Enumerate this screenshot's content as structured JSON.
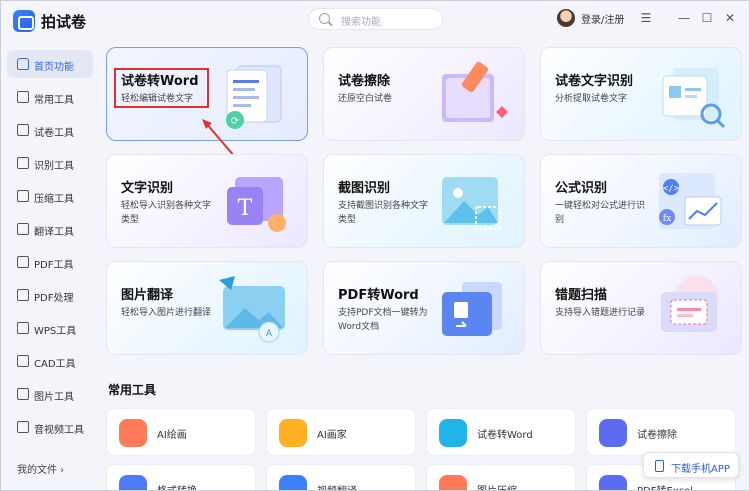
{
  "app": {
    "title": "拍试卷"
  },
  "search": {
    "placeholder": "搜索功能"
  },
  "user": {
    "login_label": "登录/注册"
  },
  "window_controls": {
    "menu": "☰",
    "minimize": "—",
    "maximize": "☐",
    "close": "✕"
  },
  "sidebar": {
    "items": [
      {
        "label": "首页功能",
        "icon": "home-icon",
        "active": true
      },
      {
        "label": "常用工具",
        "icon": "layers-icon"
      },
      {
        "label": "试卷工具",
        "icon": "document-icon"
      },
      {
        "label": "识别工具",
        "icon": "scan-icon"
      },
      {
        "label": "压缩工具",
        "icon": "compress-icon"
      },
      {
        "label": "翻译工具",
        "icon": "translate-icon"
      },
      {
        "label": "PDF工具",
        "icon": "pdf-icon"
      },
      {
        "label": "PDF处理",
        "icon": "pdf-process-icon"
      },
      {
        "label": "WPS工具",
        "icon": "wps-icon"
      },
      {
        "label": "CAD工具",
        "icon": "cad-icon"
      },
      {
        "label": "图片工具",
        "icon": "image-icon"
      },
      {
        "label": "音视频工具",
        "icon": "video-icon"
      }
    ],
    "my_files": "我的文件 ›"
  },
  "cards": [
    {
      "title": "试卷转Word",
      "desc": "轻松编辑试卷文字",
      "icon": "word-document-icon"
    },
    {
      "title": "试卷擦除",
      "desc": "还原空白试卷",
      "icon": "eraser-scroll-icon"
    },
    {
      "title": "试卷文字识别",
      "desc": "分析提取试卷文字",
      "icon": "text-scan-icon"
    },
    {
      "title": "文字识别",
      "desc": "轻松导入识别各种文字类型",
      "icon": "text-recognition-icon"
    },
    {
      "title": "截图识别",
      "desc": "支持截图识别各种文字类型",
      "icon": "screenshot-icon"
    },
    {
      "title": "公式识别",
      "desc": "一键轻松对公式进行识别",
      "icon": "formula-icon"
    },
    {
      "title": "图片翻译",
      "desc": "轻松导入图片进行翻译",
      "icon": "image-translate-icon"
    },
    {
      "title": "PDF转Word",
      "desc": "支持PDF文档一键转为Word文档",
      "icon": "pdf-to-word-icon"
    },
    {
      "title": "错题扫描",
      "desc": "支持导入错题进行记录",
      "icon": "mistake-scan-icon"
    }
  ],
  "common_tools": {
    "title": "常用工具",
    "items": [
      {
        "label": "AI绘画",
        "color": "#ff7a59"
      },
      {
        "label": "AI画家",
        "color": "#ffb020"
      },
      {
        "label": "试卷转Word",
        "color": "#21b4e8"
      },
      {
        "label": "试卷擦除",
        "color": "#5c6cf0"
      }
    ],
    "partial_items": [
      {
        "label": "格式转换",
        "color": "#4b7bf5"
      },
      {
        "label": "视频翻译",
        "color": "#3b82f6"
      },
      {
        "label": "图片压缩",
        "color": "#ff7a59"
      },
      {
        "label": "PDF转Excel",
        "color": "#5c6cf0"
      }
    ]
  },
  "download_app": {
    "label": "下载手机APP"
  }
}
